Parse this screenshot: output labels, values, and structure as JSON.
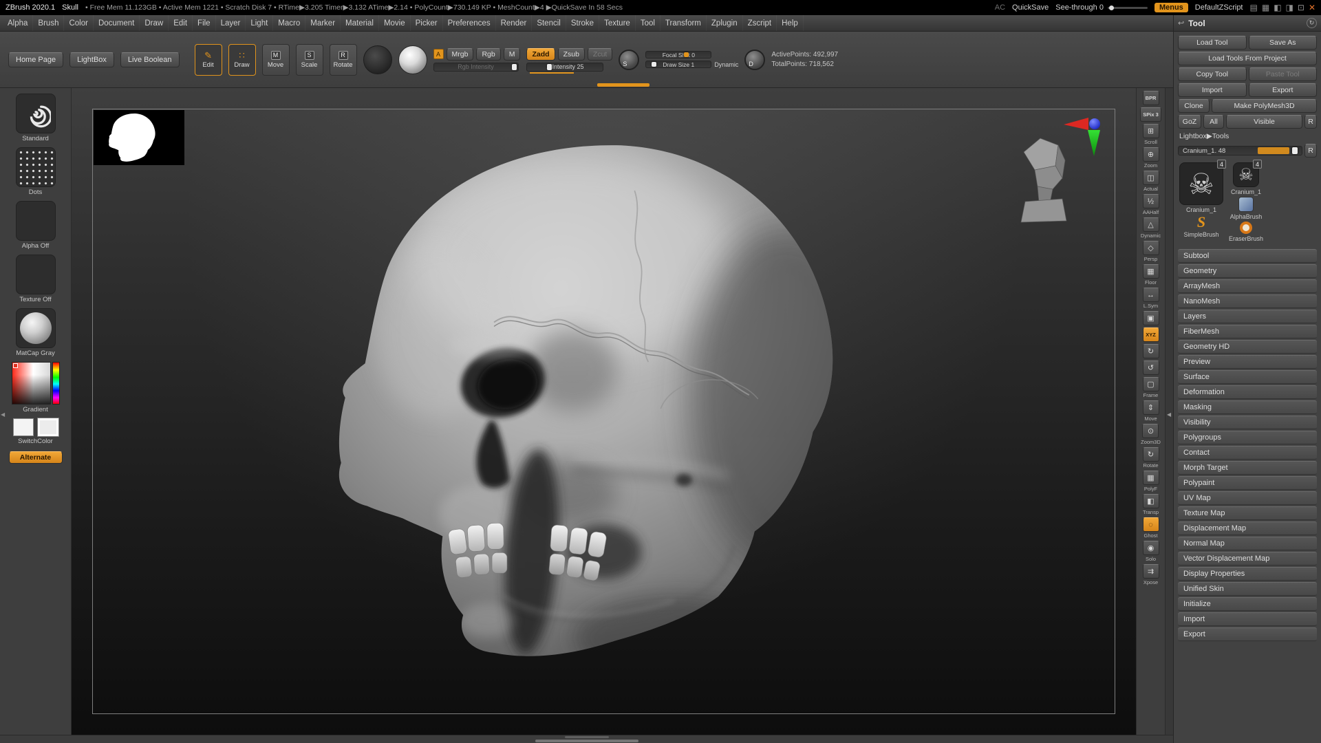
{
  "icons": {
    "close": "✕",
    "win_a": "▤",
    "win_b": "▦",
    "win_c": "◧",
    "win_d": "◨",
    "win_e": "⊡",
    "collapse_left": "◀",
    "refresh": "↻",
    "back_arrow": "↩",
    "skull": "☠",
    "pencil": "✎",
    "draw_dots": "∷"
  },
  "title_bar": {
    "app": "ZBrush 2020.1",
    "doc": "Skull",
    "stats": "• Free Mem 11.123GB • Active Mem 1221 • Scratch Disk 7 • RTime▶3.205 Timer▶3.132 ATime▶2.14 • PolyCount▶730.149 KP • MeshCount▶4 ▶QuickSave In 58 Secs",
    "ac": "AC",
    "quicksave": "QuickSave",
    "see_through": "See-through 0",
    "menus": "Menus",
    "zscript": "DefaultZScript"
  },
  "menu": {
    "items": [
      "Alpha",
      "Brush",
      "Color",
      "Document",
      "Draw",
      "Edit",
      "File",
      "Layer",
      "Light",
      "Macro",
      "Marker",
      "Material",
      "Movie",
      "Picker",
      "Preferences",
      "Render",
      "Stencil",
      "Stroke",
      "Texture",
      "Tool",
      "Transform",
      "Zplugin",
      "Zscript",
      "Help"
    ]
  },
  "shelf": {
    "home_page": "Home Page",
    "lightbox": "LightBox",
    "live_boolean": "Live Boolean",
    "edit": "Edit",
    "draw": "Draw",
    "move": "Move",
    "scale": "Scale",
    "rotate": "Rotate",
    "move_badge": "M",
    "scale_badge": "S",
    "rotate_badge": "R",
    "color_swatch": "A",
    "mrgb": "Mrgb",
    "rgb": "Rgb",
    "m": "M",
    "zadd": "Zadd",
    "zsub": "Zsub",
    "zcut": "Zcut",
    "rgb_intensity": "Rgb Intensity",
    "z_intensity": "Z Intensity 25",
    "focal_shift": "Focal Shift 0",
    "draw_size": "Draw Size 1",
    "dynamic": "Dynamic",
    "s_dial": "S",
    "d_dial": "D",
    "active_points": "ActivePoints: 492,997",
    "total_points": "TotalPoints: 718,562"
  },
  "left_tray": {
    "brush": "Standard",
    "stroke": "Dots",
    "alpha": "Alpha Off",
    "texture": "Texture Off",
    "material": "MatCap Gray",
    "gradient": "Gradient",
    "switch": "SwitchColor",
    "alternate": "Alternate"
  },
  "right_shelf": {
    "items": [
      {
        "glyph": "BPR",
        "label": "",
        "kind": "text"
      },
      {
        "glyph": "SPix 3",
        "label": "",
        "kind": "text"
      },
      {
        "glyph": "⊞",
        "label": "Scroll"
      },
      {
        "glyph": "⊕",
        "label": "Zoom"
      },
      {
        "glyph": "◫",
        "label": "Actual"
      },
      {
        "glyph": "½",
        "label": "AAHalf"
      },
      {
        "glyph": "△",
        "label": "Dynamic"
      },
      {
        "glyph": "◇",
        "label": "Persp"
      },
      {
        "glyph": "▦",
        "label": "Floor"
      },
      {
        "glyph": "↔",
        "label": "L.Sym"
      },
      {
        "glyph": "▣",
        "label": ""
      },
      {
        "glyph": "XYZ",
        "label": "",
        "kind": "text",
        "active": true
      },
      {
        "glyph": "↻",
        "label": ""
      },
      {
        "glyph": "↺",
        "label": ""
      },
      {
        "glyph": "▢",
        "label": "Frame"
      },
      {
        "glyph": "⇕",
        "label": "Move"
      },
      {
        "glyph": "⊙",
        "label": "Zoom3D"
      },
      {
        "glyph": "↻",
        "label": "Rotate"
      },
      {
        "glyph": "▦",
        "label": "PolyF"
      },
      {
        "glyph": "◧",
        "label": "Transp"
      },
      {
        "glyph": "◌",
        "label": "Ghost",
        "active": true
      },
      {
        "glyph": "◉",
        "label": "Solo"
      },
      {
        "glyph": "⇉",
        "label": "Xpose"
      }
    ]
  },
  "tool_panel": {
    "title": "Tool",
    "load_tool": "Load Tool",
    "save_as": "Save As",
    "load_from_project": "Load Tools From Project",
    "copy_tool": "Copy Tool",
    "paste_tool": "Paste Tool",
    "import": "Import",
    "export": "Export",
    "clone": "Clone",
    "make_polymesh": "Make PolyMesh3D",
    "goz": "GoZ",
    "all": "All",
    "visible": "Visible",
    "r": "R",
    "lightbox_tools": "Lightbox▶Tools",
    "active_tool_slider": "Cranium_1. 48",
    "slider_r": "R",
    "thumbs": {
      "main_label": "Cranium_1",
      "main_badge": "4",
      "second_label": "Cranium_1",
      "second_badge": "4",
      "alpha_label": "AlphaBrush",
      "simple_label": "SimpleBrush",
      "simple_glyph": "S",
      "eraser_label": "EraserBrush"
    },
    "sections": [
      "Subtool",
      "Geometry",
      "ArrayMesh",
      "NanoMesh",
      "Layers",
      "FiberMesh",
      "Geometry HD",
      "Preview",
      "Surface",
      "Deformation",
      "Masking",
      "Visibility",
      "Polygroups",
      "Contact",
      "Morph Target",
      "Polypaint",
      "UV Map",
      "Texture Map",
      "Displacement Map",
      "Normal Map",
      "Vector Displacement Map",
      "Display Properties",
      "Unified Skin",
      "Initialize",
      "Import",
      "Export"
    ]
  }
}
